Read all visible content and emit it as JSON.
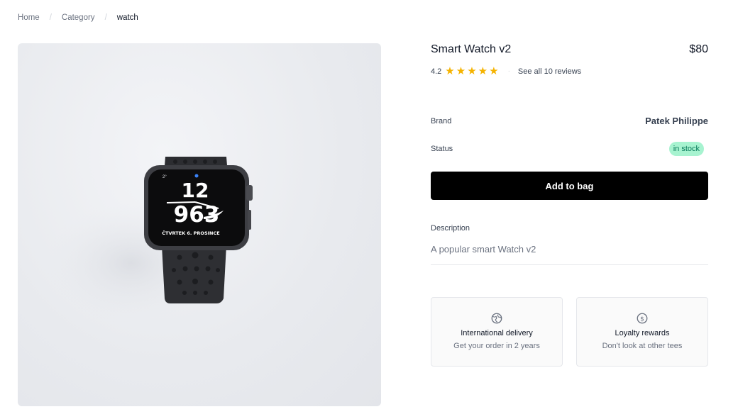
{
  "breadcrumb": {
    "items": [
      "Home",
      "Category"
    ],
    "separator": "/",
    "current": "watch"
  },
  "product": {
    "title": "Smart Watch v2",
    "price": "$80",
    "rating": "4.2",
    "stars": 5,
    "reviews_link": "See all 10 reviews",
    "brand_label": "Brand",
    "brand_value": "Patek Philippe",
    "status_label": "Status",
    "status_value": "in stock",
    "add_button": "Add to bag",
    "description_label": "Description",
    "description": "A popular smart Watch v2",
    "watch_face": {
      "complication": "2°",
      "hours_top": "12",
      "hours_mid": "963",
      "date_text": "ČTVRTEK 6. PROSINCE"
    }
  },
  "features": [
    {
      "name": "International delivery",
      "description": "Get your order in 2 years",
      "icon": "globe-icon"
    },
    {
      "name": "Loyalty rewards",
      "description": "Don't look at other tees",
      "icon": "dollar-circle-icon"
    }
  ],
  "colors": {
    "star": "#f5b300",
    "badge_bg": "#a7f3d0",
    "badge_text": "#047857",
    "button_bg": "#000000"
  }
}
